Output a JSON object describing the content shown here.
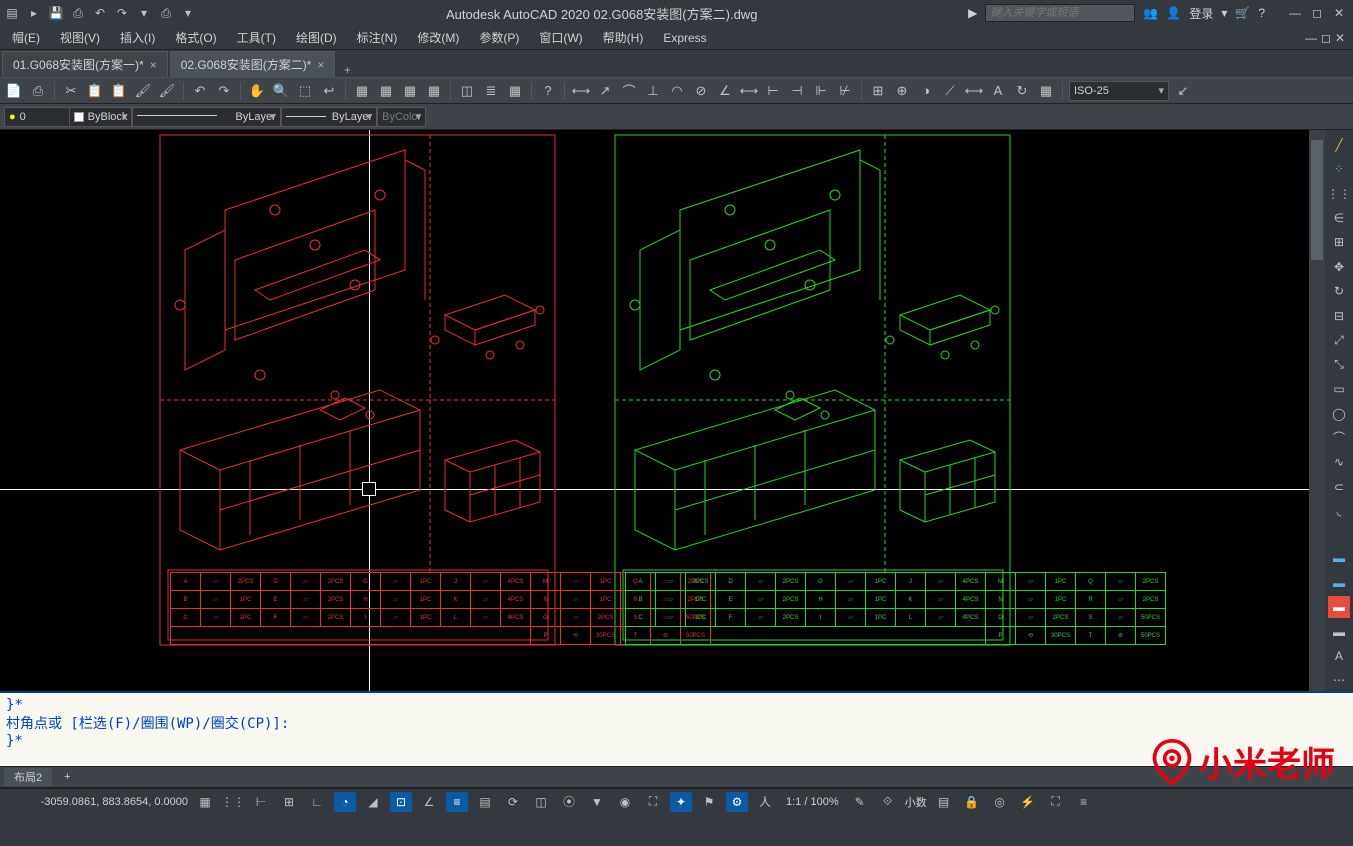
{
  "app": {
    "title": "Autodesk AutoCAD 2020   02.G068安装图(方案二).dwg",
    "search_placeholder": "键入关键字或短语",
    "login": "登录"
  },
  "menu": {
    "items": [
      "帽(E)",
      "视图(V)",
      "插入(I)",
      "格式(O)",
      "工具(T)",
      "绘图(D)",
      "标注(N)",
      "修改(M)",
      "参数(P)",
      "窗口(W)",
      "帮助(H)",
      "Express"
    ]
  },
  "tabs": {
    "items": [
      {
        "label": "01.G068安装图(方案一)*",
        "active": false
      },
      {
        "label": "02.G068安装图(方案二)*",
        "active": true
      }
    ]
  },
  "props": {
    "layer": "0",
    "color": "ByBlock",
    "linetype": "ByLayer",
    "lineweight": "ByLayer",
    "plotstyle": "ByColor",
    "dimstyle": "ISO-25"
  },
  "cmd": {
    "l1": "}*",
    "l2": "村角点或 [栏选(F)/圈围(WP)/圈交(CP)]:",
    "l3": "}*",
    "prompt": ""
  },
  "layout_tabs": [
    "布局2",
    "+"
  ],
  "status": {
    "coords": "-3059.0861, 883.8654, 0.0000",
    "scale": "1:1 / 100%",
    "units": "小数"
  },
  "watermark": "小米老师"
}
